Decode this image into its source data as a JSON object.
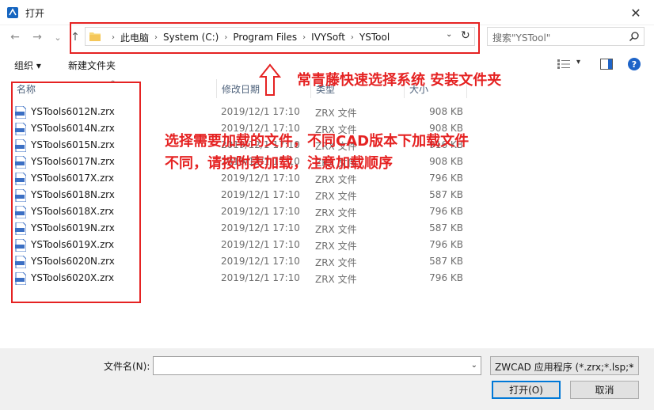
{
  "window": {
    "title": "打开",
    "close_glyph": "✕"
  },
  "nav": {
    "back": "←",
    "forward": "→",
    "recent": "⌄",
    "up": "↑"
  },
  "address": {
    "crumbs": [
      "此电脑",
      "System (C:)",
      "Program Files",
      "IVYSoft",
      "YSTool"
    ],
    "separator": "›",
    "dropdown": "⌄",
    "refresh": "↻"
  },
  "search": {
    "placeholder": "搜索\"YSTool\""
  },
  "toolbar": {
    "organize": "组织 ▾",
    "new_folder": "新建文件夹",
    "view_drop": "▾"
  },
  "columns": {
    "name": "名称",
    "date": "修改日期",
    "type": "类型",
    "size": "大小",
    "sort": "︿"
  },
  "files": [
    {
      "name": "YSTools6012N.zrx",
      "date": "2019/12/1 17:10",
      "type": "ZRX 文件",
      "size": "908 KB"
    },
    {
      "name": "YSTools6014N.zrx",
      "date": "2019/12/1 17:10",
      "type": "ZRX 文件",
      "size": "908 KB"
    },
    {
      "name": "YSTools6015N.zrx",
      "date": "2019/12/1 17:10",
      "type": "ZRX 文件",
      "size": "916 KB"
    },
    {
      "name": "YSTools6017N.zrx",
      "date": "2019/12/1 17:10",
      "type": "ZRX 文件",
      "size": "908 KB"
    },
    {
      "name": "YSTools6017X.zrx",
      "date": "2019/12/1 17:10",
      "type": "ZRX 文件",
      "size": "796 KB"
    },
    {
      "name": "YSTools6018N.zrx",
      "date": "2019/12/1 17:10",
      "type": "ZRX 文件",
      "size": "587 KB"
    },
    {
      "name": "YSTools6018X.zrx",
      "date": "2019/12/1 17:10",
      "type": "ZRX 文件",
      "size": "796 KB"
    },
    {
      "name": "YSTools6019N.zrx",
      "date": "2019/12/1 17:10",
      "type": "ZRX 文件",
      "size": "587 KB"
    },
    {
      "name": "YSTools6019X.zrx",
      "date": "2019/12/1 17:10",
      "type": "ZRX 文件",
      "size": "796 KB"
    },
    {
      "name": "YSTools6020N.zrx",
      "date": "2019/12/1 17:10",
      "type": "ZRX 文件",
      "size": "587 KB"
    },
    {
      "name": "YSTools6020X.zrx",
      "date": "2019/12/1 17:10",
      "type": "ZRX 文件",
      "size": "796 KB"
    }
  ],
  "annotations": {
    "path_note": "常青藤快速选择系统 安装文件夹",
    "files_note_1": "选择需要加载的文件，不同CAD版本下加载文件",
    "files_note_2": "不同，请按附表加载，注意加载顺序",
    "color": "#e52222"
  },
  "bottom": {
    "filename_label": "文件名(N):",
    "filename_value": "",
    "filter": "ZWCAD 应用程序 (*.zrx;*.lsp;*",
    "open": "打开(O)",
    "cancel": "取消"
  }
}
